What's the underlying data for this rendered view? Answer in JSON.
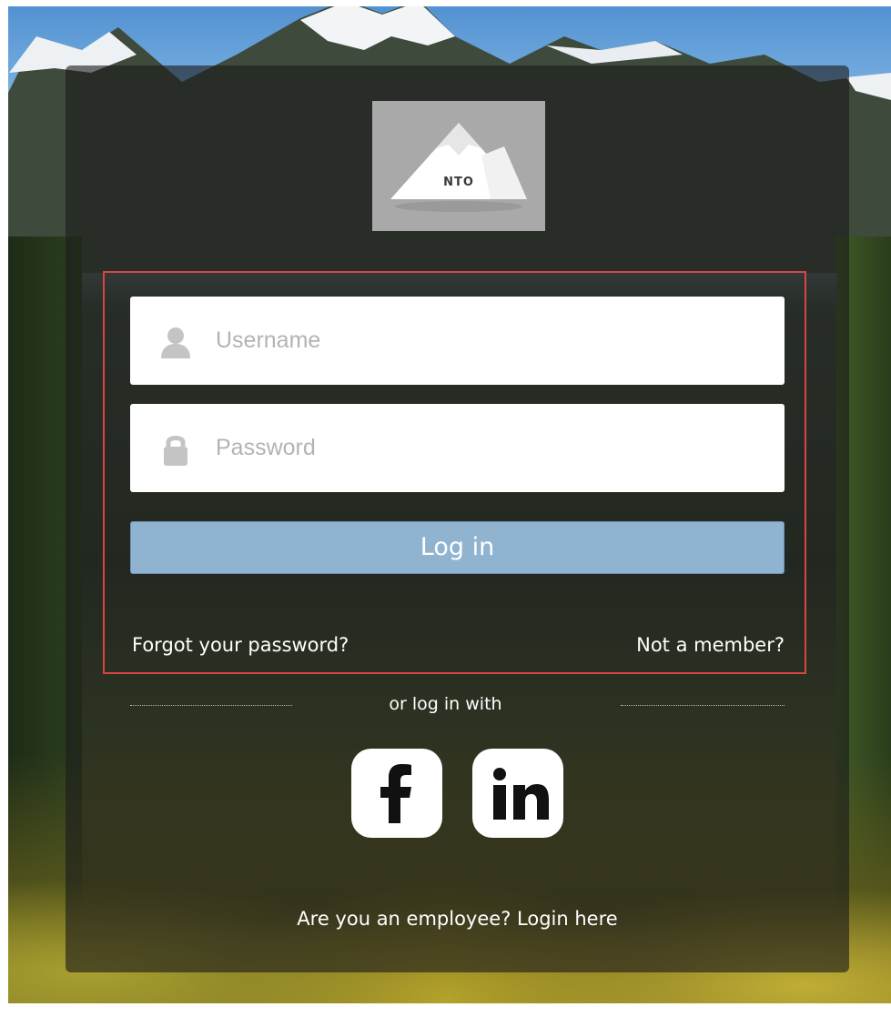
{
  "brand": {
    "logo_text": "NTO"
  },
  "login": {
    "username_placeholder": "Username",
    "password_placeholder": "Password",
    "login_label": "Log in",
    "forgot_label": "Forgot your password?",
    "not_member_label": "Not a member?"
  },
  "social": {
    "or_label": "or log in with",
    "providers": [
      "facebook",
      "linkedin"
    ]
  },
  "employee_label": "Are you an employee? Login here",
  "colors": {
    "button": "#90b4cf",
    "highlight": "#d94545",
    "card": "rgba(28,28,28,0.62)"
  },
  "icons": {
    "username": "person-icon",
    "password": "lock-icon",
    "facebook": "facebook-icon",
    "linkedin": "linkedin-icon"
  }
}
